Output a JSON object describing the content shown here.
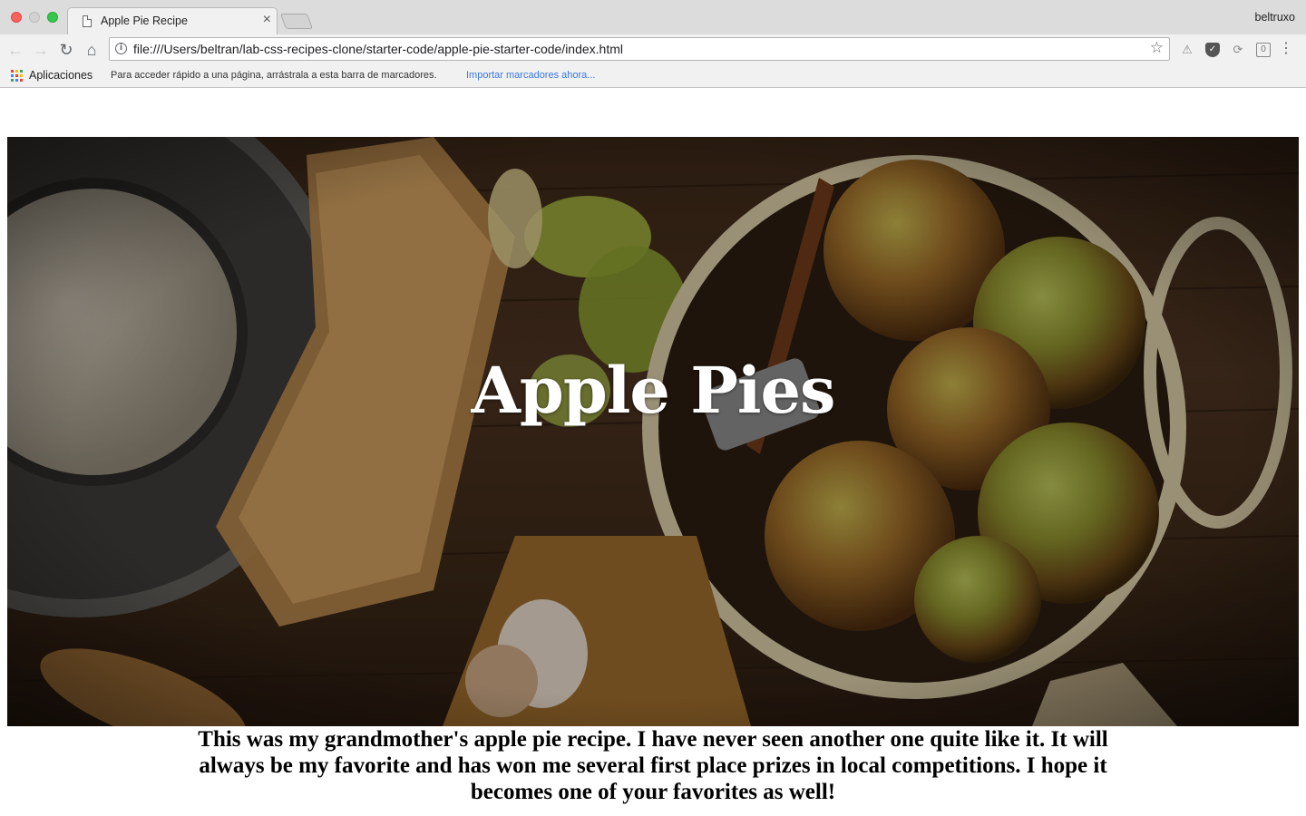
{
  "browser": {
    "tab": {
      "title": "Apple Pie Recipe",
      "close": "×"
    },
    "profile": "beltruxo",
    "url": "file:///Users/beltran/lab-css-recipes-clone/starter-code/apple-pie-starter-code/index.html",
    "bookmarks_bar": {
      "apps_label": "Aplicaciones",
      "hint": "Para acceder rápido a una página, arrástrala a esta barra de marcadores.",
      "import_link": "Importar marcadores ahora..."
    },
    "colors": {
      "traffic_red": "#fc605c",
      "traffic_green": "#34c84a",
      "link": "#3b78e7"
    }
  },
  "page": {
    "hero": {
      "title": "Apple Pies",
      "image": "overhead photo of green apples in a colander, flour sieve and recipe book on wooden table"
    },
    "intro": "This was my grandmother's apple pie recipe. I have never seen another one quite like it. It will always be my favorite and has won me several first place prizes in local competitions. I hope it becomes one of your favorites as well!"
  }
}
